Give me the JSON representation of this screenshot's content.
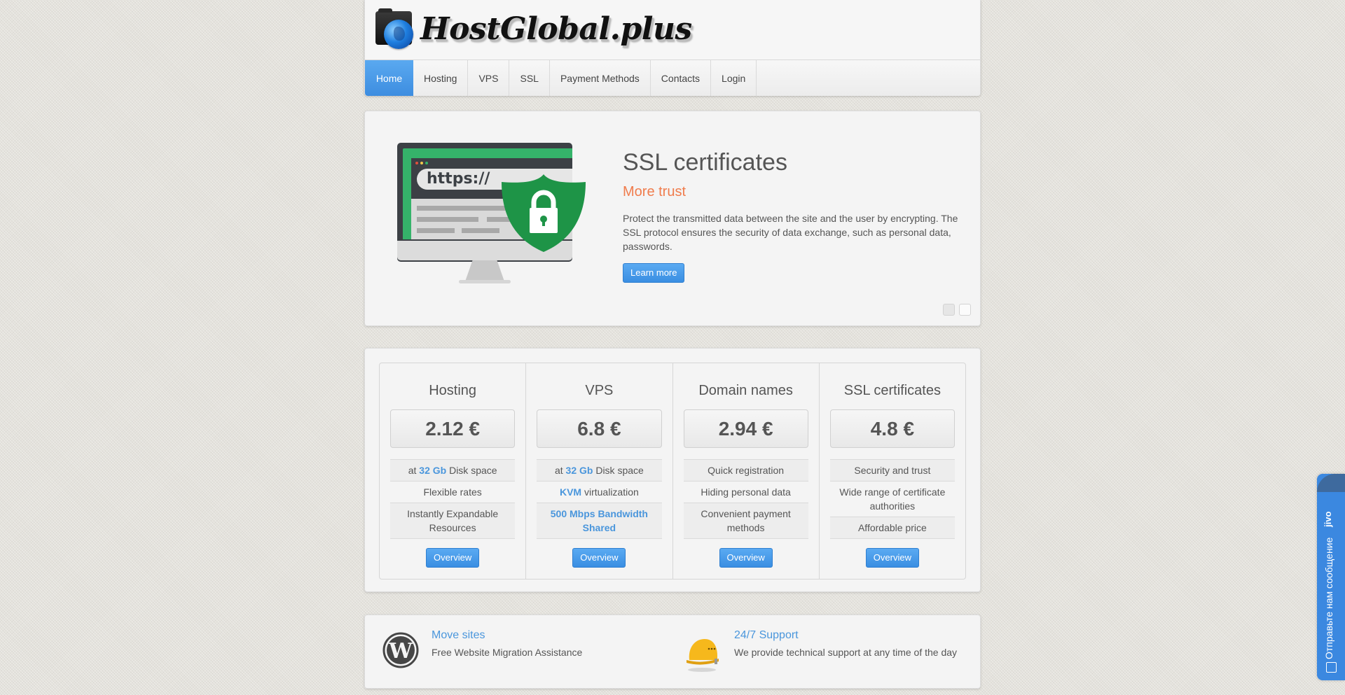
{
  "site": {
    "logo_text": "HostGlobal.plus"
  },
  "nav": {
    "items": [
      {
        "label": "Home",
        "active": true
      },
      {
        "label": "Hosting",
        "active": false
      },
      {
        "label": "VPS",
        "active": false
      },
      {
        "label": "SSL",
        "active": false
      },
      {
        "label": "Payment Methods",
        "active": false
      },
      {
        "label": "Contacts",
        "active": false
      },
      {
        "label": "Login",
        "active": false
      }
    ]
  },
  "hero": {
    "illustration_url_text": "https://",
    "title": "SSL certificates",
    "subtitle": "More trust",
    "description": "Protect the transmitted data between the site and the user by encrypting. The SSL protocol ensures the security of data exchange, such as personal data, passwords.",
    "button_label": "Learn more",
    "slides": 2,
    "active_slide": 1
  },
  "pricing": {
    "columns": [
      {
        "title": "Hosting",
        "price": "2.12 €",
        "features": [
          [
            {
              "t": "at ",
              "hl": false
            },
            {
              "t": "32 Gb",
              "hl": true
            },
            {
              "t": " Disk space",
              "hl": false
            }
          ],
          [
            {
              "t": "Flexible rates",
              "hl": false
            }
          ],
          [
            {
              "t": "Instantly Expandable Resources",
              "hl": false
            }
          ]
        ],
        "button_label": "Overview"
      },
      {
        "title": "VPS",
        "price": "6.8 €",
        "features": [
          [
            {
              "t": "at ",
              "hl": false
            },
            {
              "t": "32 Gb",
              "hl": true
            },
            {
              "t": " Disk space",
              "hl": false
            }
          ],
          [
            {
              "t": "KVM",
              "hl": true
            },
            {
              "t": " virtualization",
              "hl": false
            }
          ],
          [
            {
              "t": "500 Mbps Bandwidth Shared",
              "hl": true
            }
          ]
        ],
        "button_label": "Overview"
      },
      {
        "title": "Domain names",
        "price": "2.94 €",
        "features": [
          [
            {
              "t": "Quick registration",
              "hl": false
            }
          ],
          [
            {
              "t": "Hiding personal data",
              "hl": false
            }
          ],
          [
            {
              "t": "Convenient payment methods",
              "hl": false
            }
          ]
        ],
        "button_label": "Overview"
      },
      {
        "title": "SSL certificates",
        "price": "4.8 €",
        "features": [
          [
            {
              "t": "Security and trust",
              "hl": false
            }
          ],
          [
            {
              "t": "Wide range of certificate authorities",
              "hl": false
            }
          ],
          [
            {
              "t": "Affordable price",
              "hl": false
            }
          ]
        ],
        "button_label": "Overview"
      }
    ]
  },
  "features": [
    {
      "icon": "wordpress-icon",
      "title": "Move sites",
      "description": "Free Website Migration Assistance"
    },
    {
      "icon": "hard-hat-icon",
      "title": "24/7 Support",
      "description": "We provide technical support at any time of the day"
    }
  ],
  "chat_widget": {
    "brand": "jivo",
    "label": "Отправьте нам сообщение"
  },
  "colors": {
    "accent_blue": "#3d8de0",
    "highlight_blue": "#4a96dc",
    "subtitle_orange": "#f07c4c",
    "shield_green": "#1e9447"
  }
}
